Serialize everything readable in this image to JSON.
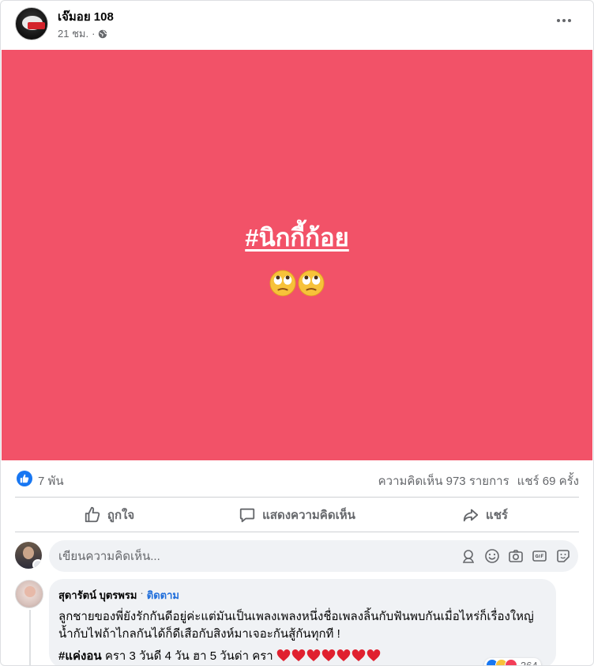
{
  "post": {
    "author": "เจ๊มอย 108",
    "time": "21 ชม.",
    "separator": "·",
    "hashtag": "#นิกกี้ก้อย",
    "background_color": "#f25268",
    "emojis": [
      "face-with-rolling-eyes",
      "face-with-rolling-eyes"
    ]
  },
  "stats": {
    "likes": "7 พัน",
    "comments": "ความคิดเห็น 973 รายการ",
    "shares": "แชร์ 69 ครั้ง"
  },
  "actions": {
    "like": "ถูกใจ",
    "comment": "แสดงความคิดเห็น",
    "share": "แชร์"
  },
  "composer": {
    "placeholder": "เขียนความคิดเห็น..."
  },
  "comment": {
    "author": "สุดารัตน์ บุตรพรม",
    "separator": "·",
    "follow": "ติดตาม",
    "text": "ลูกชายของพี่ยังรักกันดีอยู่ค่ะแต่มันเป็นเพลงเพลงหนึ่งชื่อเพลงลิ้นกับฟันพบกันเมื่อไหร่ก็เรื่องใหญ่น้ำกับไฟถ้าไกลกันได้ก็ดีเสือกับสิงห์มาเจอะกันสู้กันทุกที !",
    "hashtag": "#แค่งอน",
    "tail": "ครา 3 วันดี 4 วัน ฮา 5 วันด่า ครา",
    "hearts": 7,
    "reaction_count": "364"
  },
  "colors": {
    "accent": "#1877f2",
    "follow_link": "#216fdb",
    "secondary_text": "#65676b"
  }
}
